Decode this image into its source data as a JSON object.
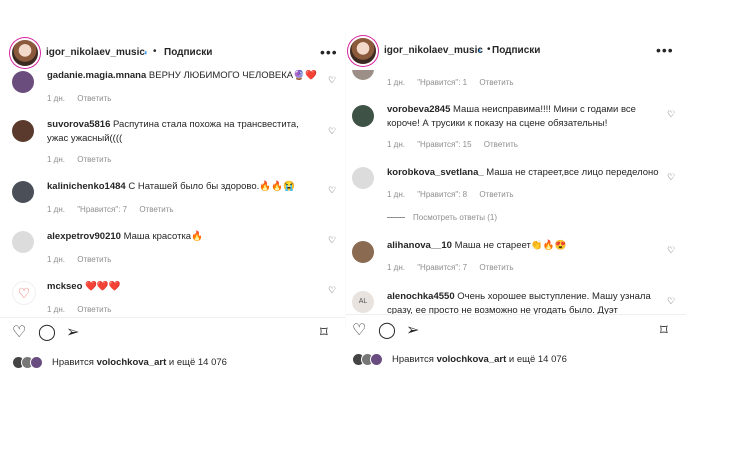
{
  "left": {
    "username": "igor_nikolaev_music",
    "follow": "Подписки",
    "more": "•••",
    "dot": "•",
    "comments": [
      {
        "user": "gadanie.magia.mnana",
        "text": "ВЕРНУ ЛЮБИМОГО ЧЕЛОВЕКА🔮❤️",
        "time": "1 дн.",
        "likes": "",
        "reply": "Ответить"
      },
      {
        "user": "suvorova5816",
        "text": "Распутина стала похожа на трансвестита, ужас ужасный((((",
        "time": "1 дн.",
        "likes": "",
        "reply": "Ответить"
      },
      {
        "user": "kalinichenko1484",
        "text": "С Наташей было бы здорово.🔥🔥😭",
        "time": "1 дн.",
        "likes": "\"Нравится\": 7",
        "reply": "Ответить"
      },
      {
        "user": "alexpetrov90210",
        "text": "Маша красотка🔥",
        "time": "1 дн.",
        "likes": "",
        "reply": "Ответить"
      },
      {
        "user": "mckseo",
        "text": "❤️❤️❤️",
        "time": "1 дн.",
        "likes": "",
        "reply": "Ответить"
      }
    ],
    "likes_prefix": "Нравится",
    "likes_user": "volochkova_art",
    "likes_suffix": "и ещё 14 076"
  },
  "right": {
    "username": "igor_nikolaev_music",
    "follow": "Подписки",
    "more": "•••",
    "dot": "•",
    "top_meta": {
      "time": "1 дн.",
      "likes": "\"Нравится\": 1",
      "reply": "Ответить"
    },
    "comments": [
      {
        "user": "vorobeva2845",
        "text": "Маша неисправима!!!! Мини с годами все короче! А трусики к показу на сцене обязательны!",
        "time": "1 дн.",
        "likes": "\"Нравится\": 15",
        "reply": "Ответить"
      },
      {
        "user": "korobkova_svetlana_",
        "text": "Маша не стареет,все лицо переделоно",
        "time": "1 дн.",
        "likes": "\"Нравится\": 8",
        "reply": "Ответить"
      },
      {
        "user": "alihanova__10",
        "text": "Маша не стареет👏🔥😍",
        "time": "1 дн.",
        "likes": "\"Нравится\": 7",
        "reply": "Ответить"
      },
      {
        "user": "alenochka4550",
        "text": "Очень хорошее выступление. Машу узнала сразу, ее просто не возможно не угодать было. Дуэт",
        "time": "",
        "likes": "",
        "reply": ""
      }
    ],
    "replies_label": "Посмотреть ответы (1)",
    "likes_prefix": "Нравится",
    "likes_user": "volochkova_art",
    "likes_suffix": "и ещё 14 076"
  },
  "icons": {
    "heart": "heart-icon",
    "comment": "comment-icon",
    "share": "share-icon",
    "bookmark": "bookmark-icon",
    "verified": "verified-icon",
    "more": "more-icon"
  },
  "colors": {
    "verified": "#3897f0",
    "meta": "#8e8e8e",
    "text": "#262626"
  }
}
